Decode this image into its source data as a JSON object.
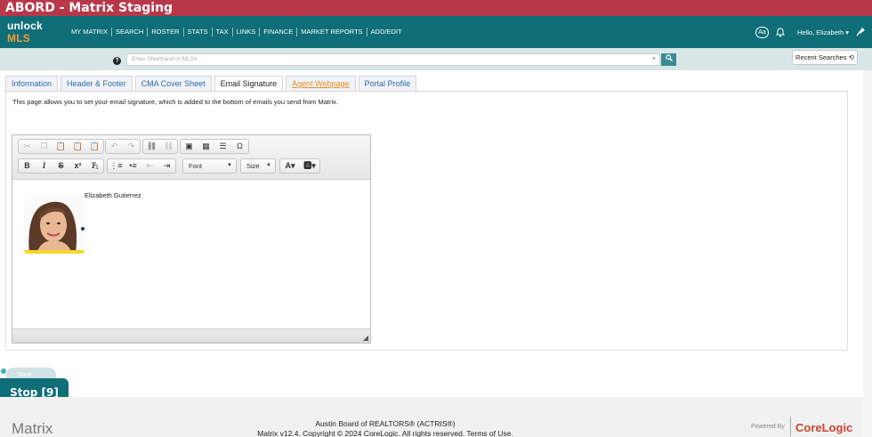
{
  "window_title": "ABORD - Matrix Staging",
  "brand": {
    "unlock": "unlock",
    "mls": "MLS"
  },
  "nav": {
    "links": [
      "MY MATRIX",
      "SEARCH",
      "ROSTER",
      "STATS",
      "TAX",
      "LINKS",
      "FINANCE",
      "MARKET REPORTS",
      "ADD/EDIT"
    ],
    "font_size_button": "Aa",
    "greeting": "Hello, Elizabeth"
  },
  "search": {
    "placeholder": "Enter Shorthand or MLS#",
    "clear": "×",
    "recent_label": "Recent Searches"
  },
  "tabs": [
    "Information",
    "Header & Footer",
    "CMA Cover Sheet",
    "Email Signature",
    "Agent Webpage",
    "Portal Profile"
  ],
  "active_tab": "Email Signature",
  "description": "This page allows you to set your email signature, which is added to the bottom of emails you send from Matrix.",
  "editor": {
    "font_label": "Font",
    "size_label": "Size",
    "signature_name": "Elizabeth Gutierrez"
  },
  "save_label": "Save",
  "stop_label": "Stop [9]",
  "footer": {
    "logo": "Matrix",
    "line1": "Austin Board of REALTORS® (ACTRIS®)",
    "line2": "Matrix v12.4. Copyright © 2024 CoreLogic. All rights reserved. Terms of Use.",
    "powered_by": "Powered By",
    "corelogic": "CoreLogic"
  },
  "colors": {
    "title_bar": "#b8384a",
    "nav_bar": "#0f6e78",
    "accent_orange": "#f29b38"
  }
}
